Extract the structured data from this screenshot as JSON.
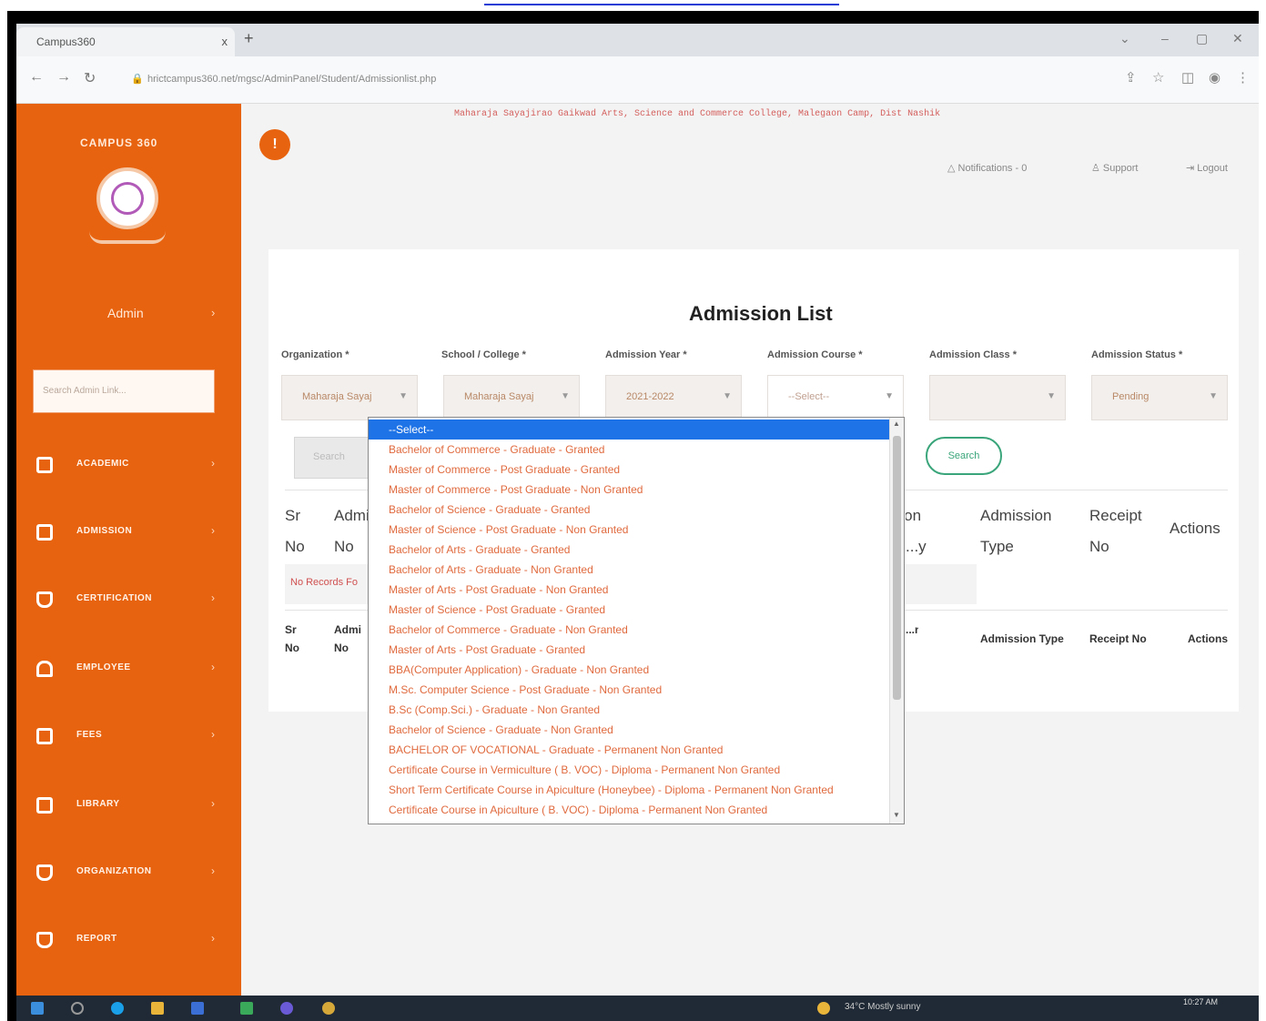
{
  "browser": {
    "tab_title": "Campus360",
    "tab_close": "x",
    "new_tab": "+",
    "url": "hrictcampus360.net/mgsc/AdminPanel/Student/Admissionlist.php"
  },
  "sidebar": {
    "brand": "CAMPUS 360",
    "user_label": "Admin",
    "search_placeholder": "Search Admin Link...",
    "items": [
      {
        "label": "ACADEMIC",
        "icon": "calendar-icon"
      },
      {
        "label": "ADMISSION",
        "icon": "calendar-icon"
      },
      {
        "label": "CERTIFICATION",
        "icon": "monitor-icon"
      },
      {
        "label": "EMPLOYEE",
        "icon": "home-icon"
      },
      {
        "label": "FEES",
        "icon": "calendar-icon"
      },
      {
        "label": "LIBRARY",
        "icon": "calendar-icon"
      },
      {
        "label": "ORGANIZATION",
        "icon": "monitor-icon"
      },
      {
        "label": "REPORT",
        "icon": "monitor-icon"
      }
    ]
  },
  "header": {
    "college_name": "Maharaja Sayajirao Gaikwad Arts, Science and Commerce College, Malegaon Camp, Dist Nashik",
    "notifications": "Notifications - 0",
    "support": "Support",
    "logout": "Logout"
  },
  "page": {
    "title": "Admission List",
    "filters": [
      {
        "label": "Organization *",
        "value": "Maharaja Sayaj"
      },
      {
        "label": "School / College *",
        "value": "Maharaja Sayaj"
      },
      {
        "label": "Admission Year *",
        "value": "2021-2022"
      },
      {
        "label": "Admission Course *",
        "value": "--Select--"
      },
      {
        "label": "Admission Class *",
        "value": ""
      },
      {
        "label": "Admission Status *",
        "value": "Pending"
      }
    ],
    "reset_label": "Search",
    "search_label": "Search",
    "table_headers": [
      "Sr No",
      "Admi No",
      "...on ...y",
      "Admission Type",
      "Receipt No",
      "Actions"
    ],
    "no_records": "No Records Fo",
    "footer_headers": [
      "Sr No",
      "Admi No",
      "...n",
      "Admission Type",
      "Receipt No",
      "Actions"
    ]
  },
  "dropdown": {
    "options": [
      "--Select--",
      "Bachelor of Commerce - Graduate - Granted",
      "Master of Commerce - Post Graduate - Granted",
      "Master of Commerce - Post Graduate - Non Granted",
      "Bachelor of Science - Graduate - Granted",
      "Master of Science - Post Graduate - Non Granted",
      "Bachelor of Arts - Graduate - Granted",
      "Bachelor of Arts - Graduate - Non Granted",
      "Master of Arts - Post Graduate - Non Granted",
      "Master of Science - Post Graduate - Granted",
      "Bachelor of Commerce - Graduate - Non Granted",
      "Master of Arts - Post Graduate - Granted",
      "BBA(Computer Application) - Graduate - Non Granted",
      "M.Sc. Computer Science - Post Graduate - Non Granted",
      "B.Sc (Comp.Sci.) - Graduate - Non Granted",
      "Bachelor of Science - Graduate - Non Granted",
      "BACHELOR OF VOCATIONAL - Graduate - Permanent Non Granted",
      "Certificate Course in Vermiculture ( B. VOC) - Diploma - Permanent Non Granted",
      "Short Term Certificate Course in Apiculture (Honeybee) - Diploma - Permanent Non Granted",
      "Certificate Course in Apiculture ( B. VOC) - Diploma - Permanent Non Granted"
    ]
  },
  "taskbar": {
    "weather": "34°C  Mostly sunny",
    "time": "10:27 AM"
  },
  "colors": {
    "sidebar": "#e8630f",
    "accent_green": "#3aa57a",
    "selection_blue": "#1e73e6",
    "option_text": "#e06a3e"
  }
}
